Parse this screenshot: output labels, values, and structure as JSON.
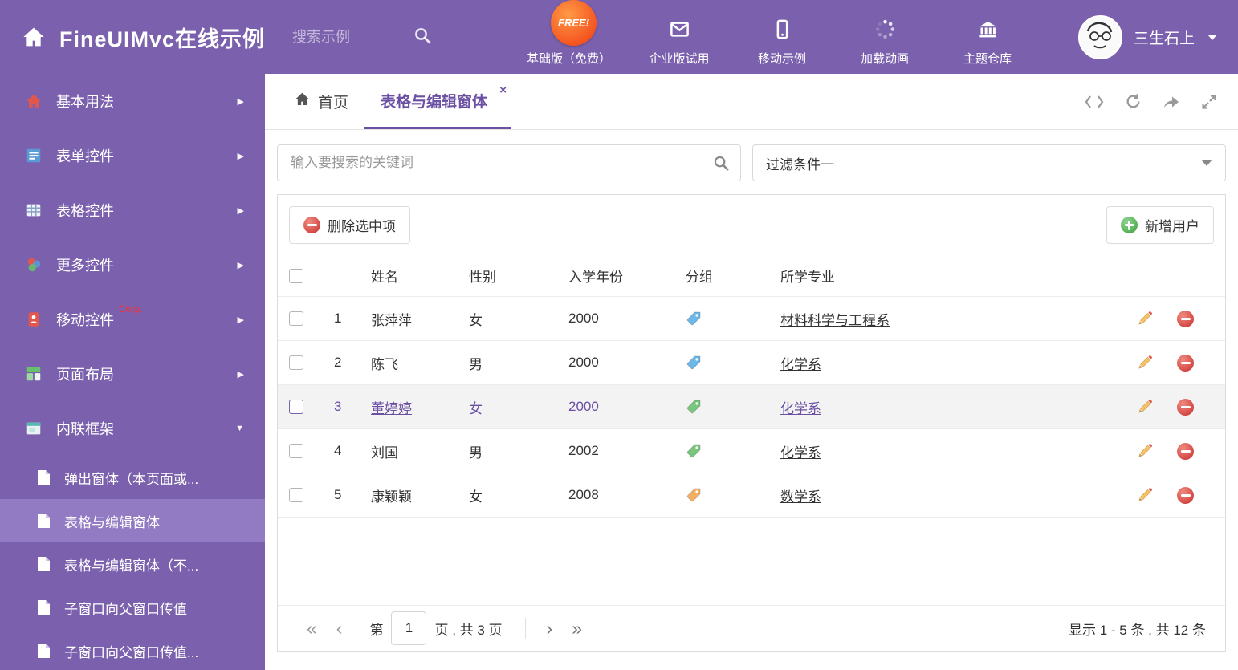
{
  "header": {
    "title": "FineUIMvc在线示例",
    "search_placeholder": "搜索示例",
    "free_badge": "FREE!",
    "nav": [
      {
        "label": "基础版（免费）"
      },
      {
        "label": "企业版试用"
      },
      {
        "label": "移动示例"
      },
      {
        "label": "加载动画"
      },
      {
        "label": "主题仓库"
      }
    ],
    "user": {
      "name": "三生石上"
    }
  },
  "sidebar": {
    "items": [
      {
        "label": "基本用法"
      },
      {
        "label": "表单控件"
      },
      {
        "label": "表格控件"
      },
      {
        "label": "更多控件"
      },
      {
        "label": "移动控件",
        "badge": "Corp."
      },
      {
        "label": "页面布局"
      },
      {
        "label": "内联框架"
      }
    ],
    "subitems": [
      {
        "label": "弹出窗体（本页面或..."
      },
      {
        "label": "表格与编辑窗体"
      },
      {
        "label": "表格与编辑窗体（不..."
      },
      {
        "label": "子窗口向父窗口传值"
      },
      {
        "label": "子窗口向父窗口传值..."
      }
    ]
  },
  "tabbar": {
    "home_tab": "首页",
    "active_tab": "表格与编辑窗体",
    "close_glyph": "×"
  },
  "filter": {
    "search_placeholder": "输入要搜索的关键词",
    "dropdown_value": "过滤条件一"
  },
  "toolbar": {
    "delete_button": "删除选中项",
    "add_button": "新增用户"
  },
  "table": {
    "columns": {
      "name": "姓名",
      "gender": "性别",
      "year": "入学年份",
      "group": "分组",
      "major": "所学专业"
    },
    "rows": [
      {
        "num": "1",
        "name": "张萍萍",
        "gender": "女",
        "year": "2000",
        "tag_color": "#6cb8e8",
        "major": "材料科学与工程系"
      },
      {
        "num": "2",
        "name": "陈飞",
        "gender": "男",
        "year": "2000",
        "tag_color": "#6cb8e8",
        "major": "化学系"
      },
      {
        "num": "3",
        "name": "董婷婷",
        "gender": "女",
        "year": "2000",
        "tag_color": "#79c67d",
        "major": "化学系"
      },
      {
        "num": "4",
        "name": "刘国",
        "gender": "男",
        "year": "2002",
        "tag_color": "#79c67d",
        "major": "化学系"
      },
      {
        "num": "5",
        "name": "康颖颖",
        "gender": "女",
        "year": "2008",
        "tag_color": "#f3b064",
        "major": "数学系"
      }
    ]
  },
  "pagination": {
    "first": "«",
    "prev": "‹",
    "next": "›",
    "last": "»",
    "page_label_before": "第",
    "current_page": "1",
    "page_label_after": "页 , 共 3 页",
    "summary": "显示 1 - 5 条 , 共 12 条"
  },
  "colors": {
    "theme_purple": "#7b61ad",
    "active_purple": "#6a4fa3",
    "selected_item_bg": "#927bc2",
    "delete_red": "#d9534f",
    "add_green": "#5cb85c",
    "pencil_orange": "#f0ad4e",
    "corp_red": "#ff2d2d"
  }
}
